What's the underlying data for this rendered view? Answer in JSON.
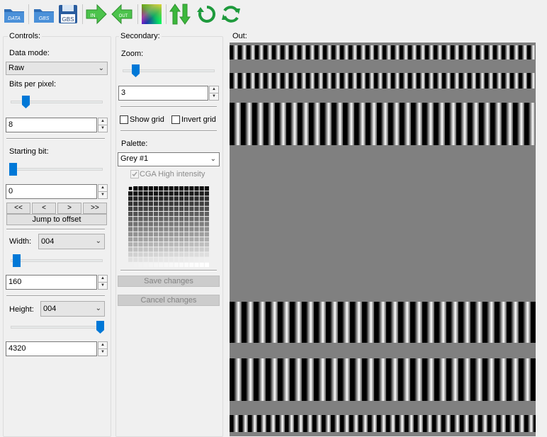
{
  "toolbar": {
    "buttons": [
      {
        "name": "open-data-button",
        "icon": "folder-data-icon",
        "text": "DATA",
        "kind": "folder"
      },
      {
        "name": "open-gbs-button",
        "icon": "folder-gbs-icon",
        "text": "GBS",
        "kind": "folder"
      },
      {
        "name": "save-gbs-button",
        "icon": "floppy-gbs-icon",
        "text": "GBS",
        "kind": "floppy"
      },
      {
        "name": "import-button",
        "icon": "arrow-in-icon",
        "text": "IN",
        "kind": "arrow-right"
      },
      {
        "name": "export-button",
        "icon": "arrow-out-icon",
        "text": "OUT",
        "kind": "arrow-left"
      },
      {
        "name": "palette-editor-button",
        "icon": "color-spectrum-icon",
        "text": "",
        "kind": "spectrum"
      },
      {
        "name": "swap-vertical-button",
        "icon": "updown-arrows-icon",
        "text": "",
        "kind": "updown"
      },
      {
        "name": "rotate-button",
        "icon": "rotate-icon",
        "text": "",
        "kind": "rotate"
      },
      {
        "name": "refresh-button",
        "icon": "refresh-icon",
        "text": "",
        "kind": "refresh"
      }
    ]
  },
  "controls": {
    "title": "Controls:",
    "data_mode_label": "Data mode:",
    "data_mode_value": "Raw",
    "bpp_label": "Bits per pixel:",
    "bpp_value": "8",
    "bpp_level": 0.12,
    "start_bit_label": "Starting bit:",
    "start_bit_value": "0",
    "start_bit_level": 0.0,
    "nav": [
      "<<",
      "<",
      ">",
      ">>"
    ],
    "jump_label": "Jump to offset",
    "width_label": "Width:",
    "width_preset": "004",
    "width_value": "160",
    "width_level": 0.0,
    "height_label": "Height:",
    "height_preset": "004",
    "height_value": "4320",
    "height_level": 1.0
  },
  "secondary": {
    "title": "Secondary:",
    "zoom_label": "Zoom:",
    "zoom_value": "3",
    "zoom_level": 0.12,
    "show_grid_label": "Show grid",
    "show_grid_checked": false,
    "invert_grid_label": "Invert grid",
    "invert_grid_checked": false,
    "palette_label": "Palette:",
    "palette_value": "Grey #1",
    "cga_label": "CGA High intensity",
    "cga_checked": true,
    "save_label": "Save changes",
    "cancel_label": "Cancel changes"
  },
  "output": {
    "title": "Out:"
  },
  "colors": {
    "accent": "#0078d7",
    "green_arrow": "#3cb83c",
    "folder": "#3b7fc4",
    "canvas_bg": "#808080"
  }
}
